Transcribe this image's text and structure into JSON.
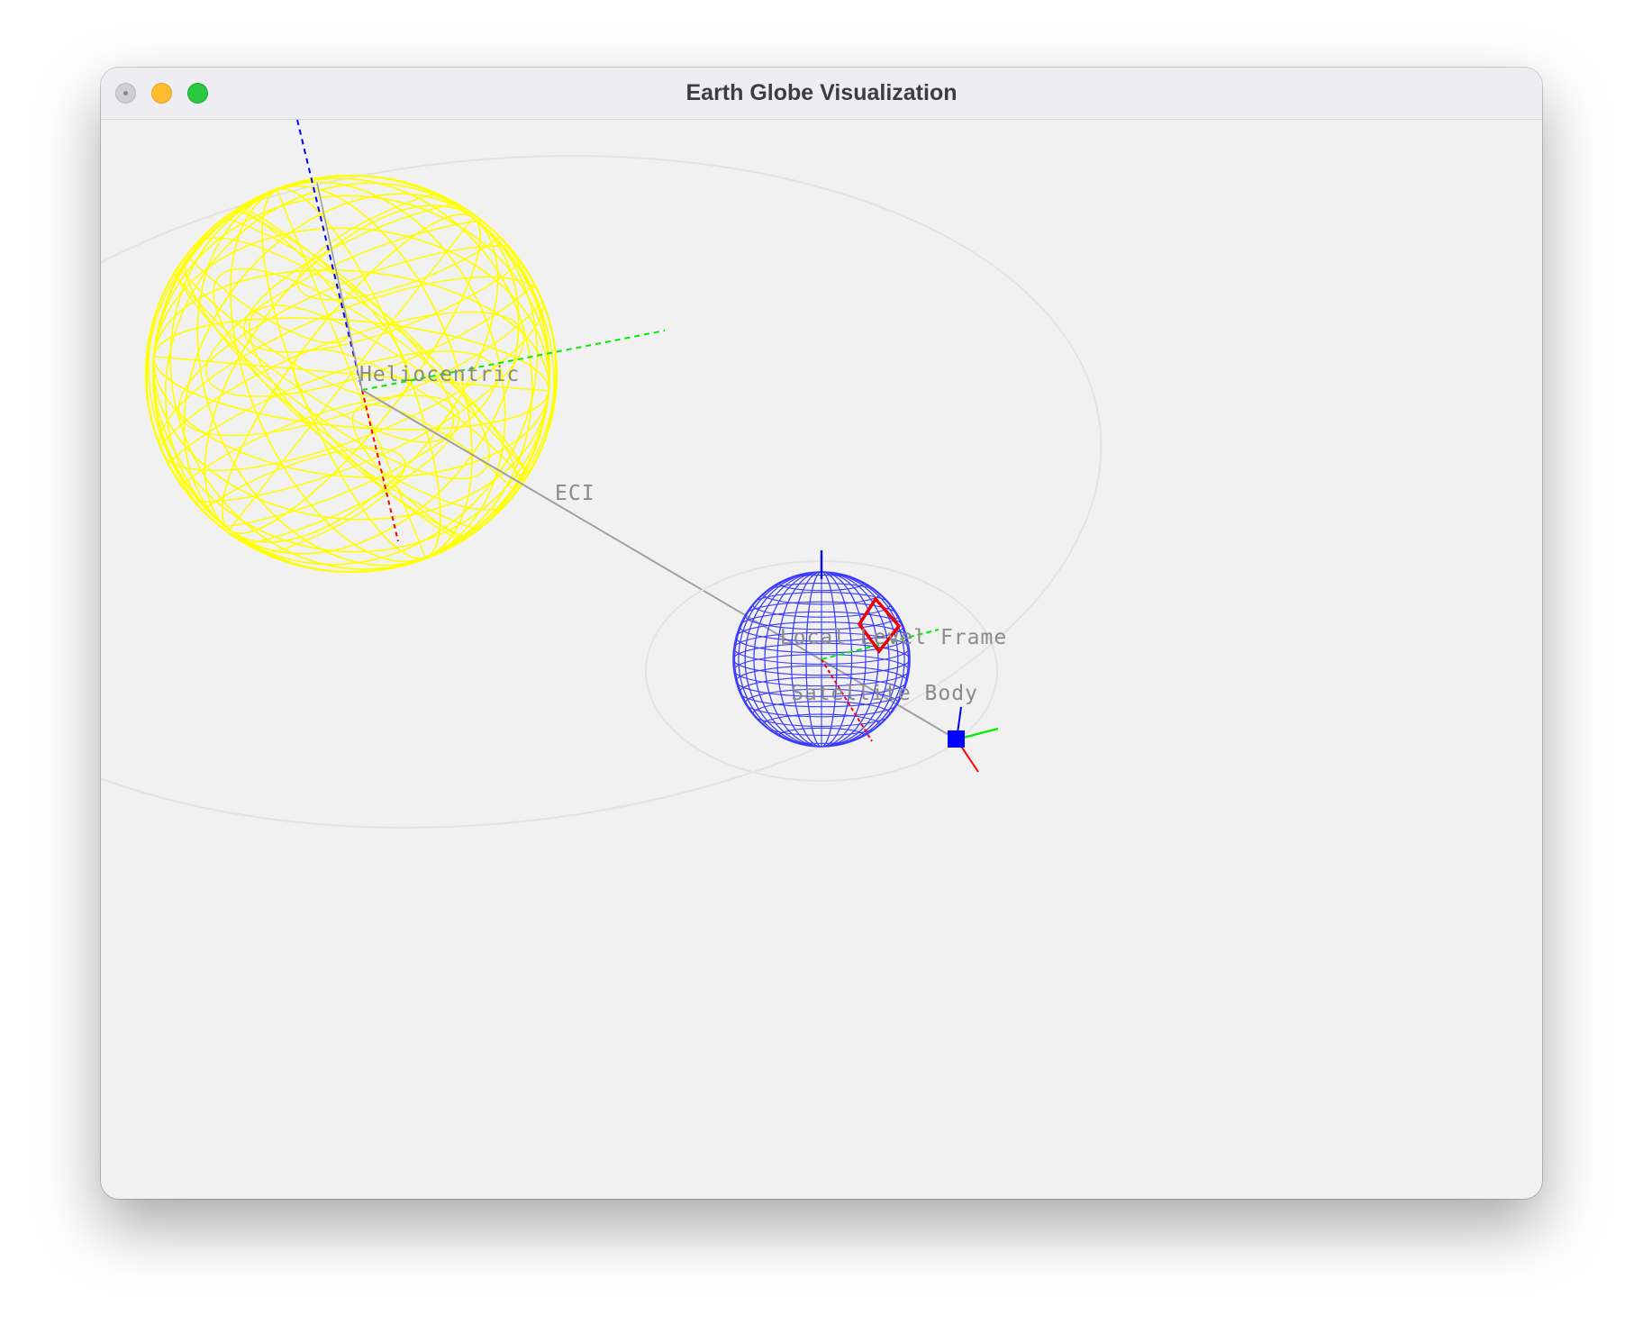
{
  "window": {
    "title": "Earth Globe Visualization"
  },
  "scene": {
    "labels": {
      "heliocentric": "Heliocentric",
      "eci": "ECI",
      "local_level": "Local Level Frame",
      "satellite_body": "Satellite Body"
    }
  },
  "colors": {
    "sun_wireframe": "#ffff00",
    "earth_wireframe": "#3b3bff",
    "axis_x": "#ff0000",
    "axis_y": "#00ee00",
    "axis_z": "#0000ff",
    "orbit": "#e0e0e0",
    "connector": "#a0a0a0",
    "sensor_footprint": "#ff0000",
    "satellite": "#0000ff"
  }
}
